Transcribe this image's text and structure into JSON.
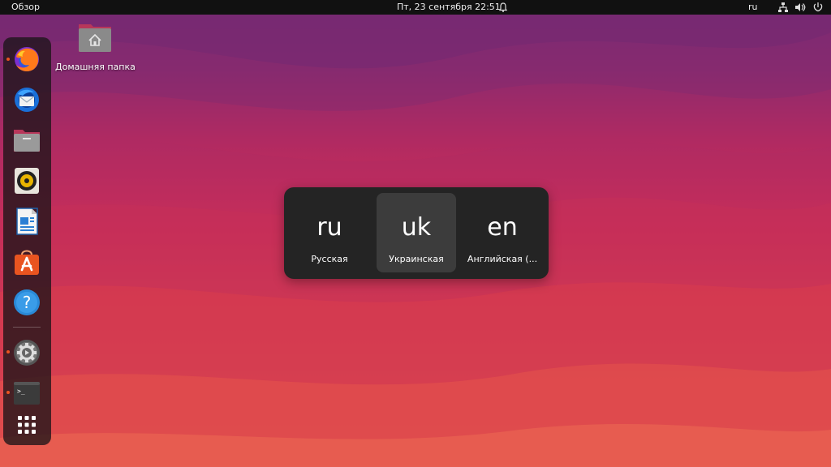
{
  "topbar": {
    "overview_label": "Обзор",
    "datetime": "Пт, 23 сентября  22:51",
    "keyboard_layout": "ru",
    "icons": [
      "alarm-bell-icon",
      "network-icon",
      "volume-icon",
      "power-icon"
    ]
  },
  "desktop": {
    "home_folder_label": "Домашняя папка"
  },
  "dock": {
    "apps": [
      {
        "icon": "firefox-icon",
        "running": true
      },
      {
        "icon": "thunderbird-icon",
        "running": false
      },
      {
        "icon": "files-icon",
        "running": false
      },
      {
        "icon": "rhythmbox-icon",
        "running": false
      },
      {
        "icon": "libreoffice-writer-icon",
        "running": false
      },
      {
        "icon": "ubuntu-software-icon",
        "running": false
      },
      {
        "icon": "help-icon",
        "running": false
      },
      {
        "icon": "settings-icon",
        "running": true
      },
      {
        "icon": "terminal-icon",
        "running": true
      },
      {
        "icon": "show-applications-icon",
        "running": false
      }
    ],
    "running_color": "#e95420"
  },
  "input_switcher": {
    "sources": [
      {
        "code": "ru",
        "name": "Русская",
        "selected": false
      },
      {
        "code": "uk",
        "name": "Украинская",
        "selected": true
      },
      {
        "code": "en",
        "name": "Английская (...",
        "selected": false
      }
    ]
  },
  "colors": {
    "topbar_bg": "#111111",
    "popup_bg": "#242424",
    "popup_selected_bg": "#3c3c3c",
    "accent": "#e95420"
  }
}
